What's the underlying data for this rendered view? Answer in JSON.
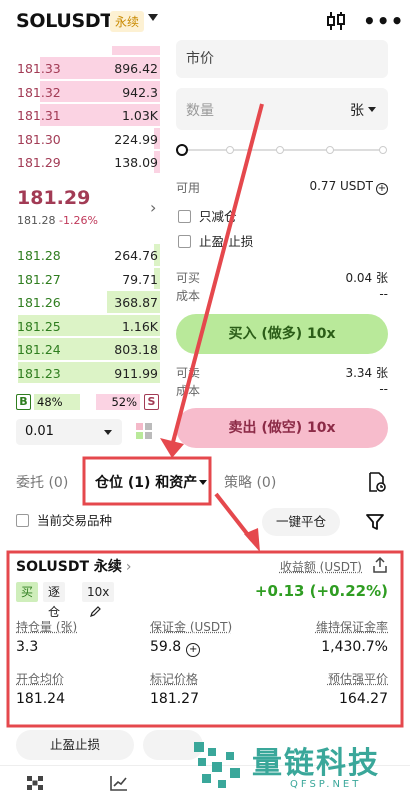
{
  "header": {
    "pair": "SOLUSDT",
    "tag": "永续"
  },
  "orderbook": {
    "asks": [
      {
        "price": "",
        "amount": "",
        "depth": 0.3
      },
      {
        "price": "181.33",
        "amount": "896.42",
        "depth": 0.75
      },
      {
        "price": "181.32",
        "amount": "942.3",
        "depth": 0.75
      },
      {
        "price": "181.31",
        "amount": "1.03K",
        "depth": 0.75
      },
      {
        "price": "181.30",
        "amount": "224.99",
        "depth": 0.04
      },
      {
        "price": "181.29",
        "amount": "138.09",
        "depth": 0.04
      }
    ],
    "last_price": "181.29",
    "mark_price": "181.28",
    "change": "-1.26%",
    "bids": [
      {
        "price": "181.28",
        "amount": "264.76",
        "depth": 0.04
      },
      {
        "price": "181.27",
        "amount": "79.71",
        "depth": 0.04
      },
      {
        "price": "181.26",
        "amount": "368.87",
        "depth": 0.33
      },
      {
        "price": "181.25",
        "amount": "1.16K",
        "depth": 0.89
      },
      {
        "price": "181.24",
        "amount": "803.18",
        "depth": 0.89
      },
      {
        "price": "181.23",
        "amount": "911.99",
        "depth": 0.89
      }
    ],
    "buy_label": "B",
    "buy_pct": "48%",
    "sell_pct": "52%",
    "sell_label": "S",
    "depth_value": "0.01"
  },
  "order_form": {
    "order_type": "市价",
    "qty_placeholder": "数量",
    "qty_unit": "张",
    "available_label": "可用",
    "available_value": "0.77 USDT",
    "reduce_only": "只减仓",
    "tp_sl": "止盈/止损",
    "can_buy_label": "可买",
    "can_buy_value": "0.04 张",
    "cost_label": "成本",
    "cost_value": "--",
    "buy_button": "买入 (做多) 10x",
    "can_sell_label": "可卖",
    "can_sell_value": "3.34 张",
    "cost2_label": "成本",
    "cost2_value": "--",
    "sell_button": "卖出 (做空) 10x"
  },
  "tabs": [
    {
      "label": "委托 (0)"
    },
    {
      "label": "仓位 (1) 和资产"
    },
    {
      "label": "策略 (0)"
    }
  ],
  "positions_bar": {
    "current_only": "当前交易品种",
    "close_all": "一键平仓"
  },
  "position": {
    "title": "SOLUSDT 永续",
    "pnl_label": "收益额 (USDT)",
    "pnl_value": "+0.13 (+0.22%)",
    "side": "买",
    "margin_mode": "逐仓",
    "leverage": "10x",
    "size_label": "持仓量 (张)",
    "size_value": "3.3",
    "margin_label": "保证金 (USDT)",
    "margin_value": "59.8",
    "mmr_label": "维持保证金率",
    "mmr_value": "1,430.7%",
    "entry_label": "开仓均价",
    "entry_value": "181.24",
    "mark_label": "标记价格",
    "mark_value": "181.27",
    "liq_label": "预估强平价",
    "liq_value": "164.27"
  },
  "bottom": {
    "tp_sl_button": "止盈止损"
  },
  "watermark": {
    "text": "量链科技",
    "sub": "QFSP.NET"
  },
  "colors": {
    "buy": "#2f7d1f",
    "sell": "#a23b55",
    "annotation": "#e5484d"
  }
}
